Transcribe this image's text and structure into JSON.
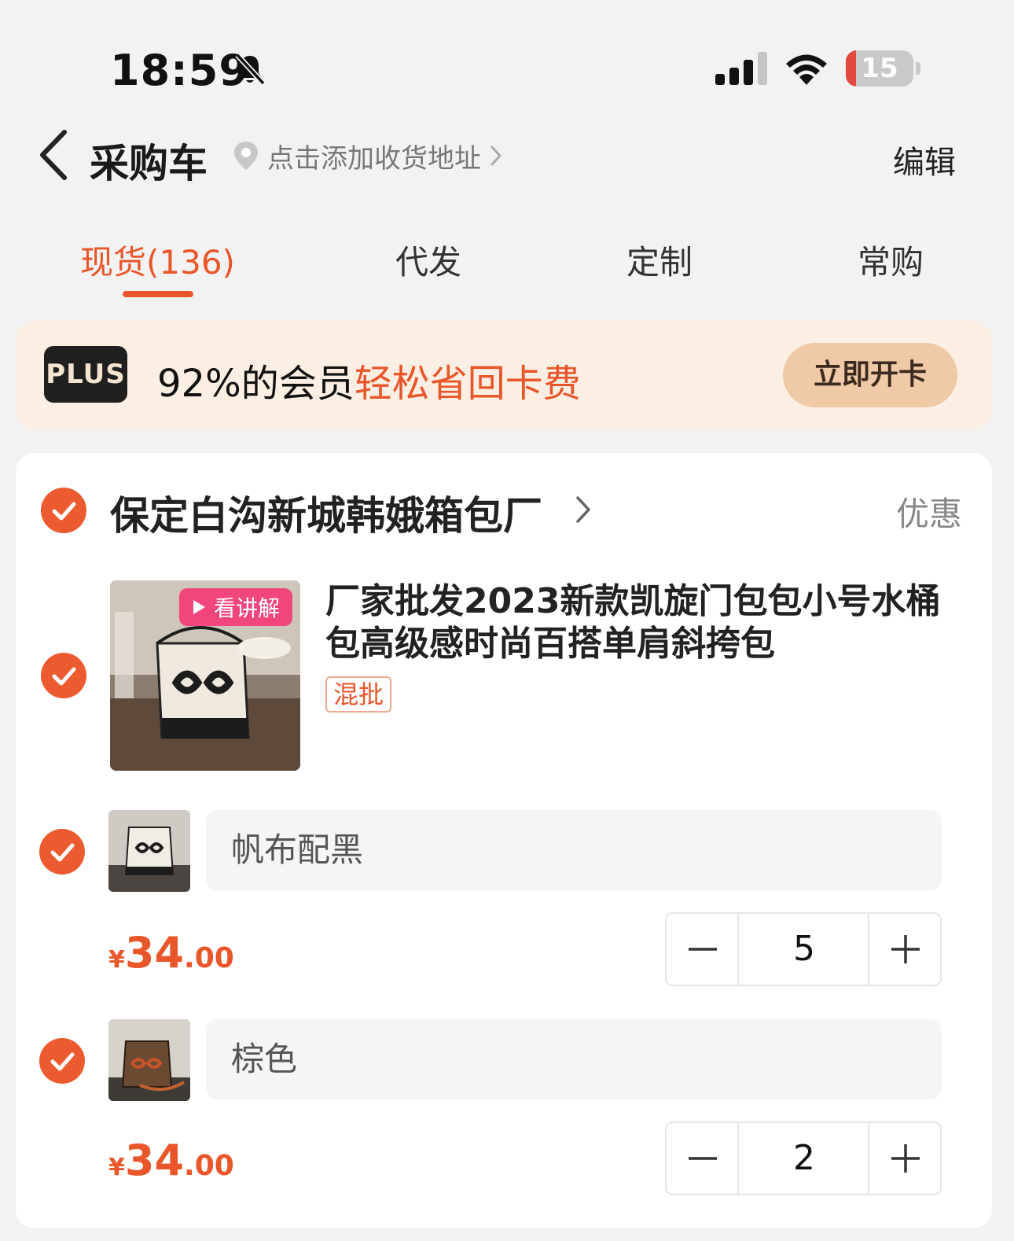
{
  "status_bar": {
    "time": "18:59",
    "battery": "15",
    "battery_level": 0.15
  },
  "header": {
    "title": "采购车",
    "address_prompt": "点击添加收货地址",
    "edit_label": "编辑"
  },
  "tabs": [
    {
      "label": "现货(136)",
      "active": true
    },
    {
      "label": "代发",
      "active": false
    },
    {
      "label": "定制",
      "active": false
    },
    {
      "label": "常购",
      "active": false
    }
  ],
  "plus_banner": {
    "badge": "PLUS",
    "text_prefix": "92%的会员",
    "text_highlight": "轻松省回卡费",
    "button_label": "立即开卡"
  },
  "shop": {
    "name": "保定白沟新城韩娥箱包厂",
    "promo_label": "优惠",
    "product": {
      "title": "厂家批发2023新款凯旋门包包小号水桶包高级感时尚百搭单肩斜挎包",
      "video_tag": "看讲解",
      "mix_tag": "混批"
    },
    "skus": [
      {
        "name": "帆布配黑",
        "currency": "¥",
        "price_int": "34",
        "price_dec": ".00",
        "quantity": "5",
        "checked": true
      },
      {
        "name": "棕色",
        "currency": "¥",
        "price_int": "34",
        "price_dec": ".00",
        "quantity": "2",
        "checked": true
      }
    ]
  },
  "colors": {
    "accent": "#e8562a",
    "checkbox": "#ec5b30",
    "banner_bg": "#fbeee3",
    "button_bg": "#f0c9a6",
    "video_tag": "#f0467c"
  }
}
